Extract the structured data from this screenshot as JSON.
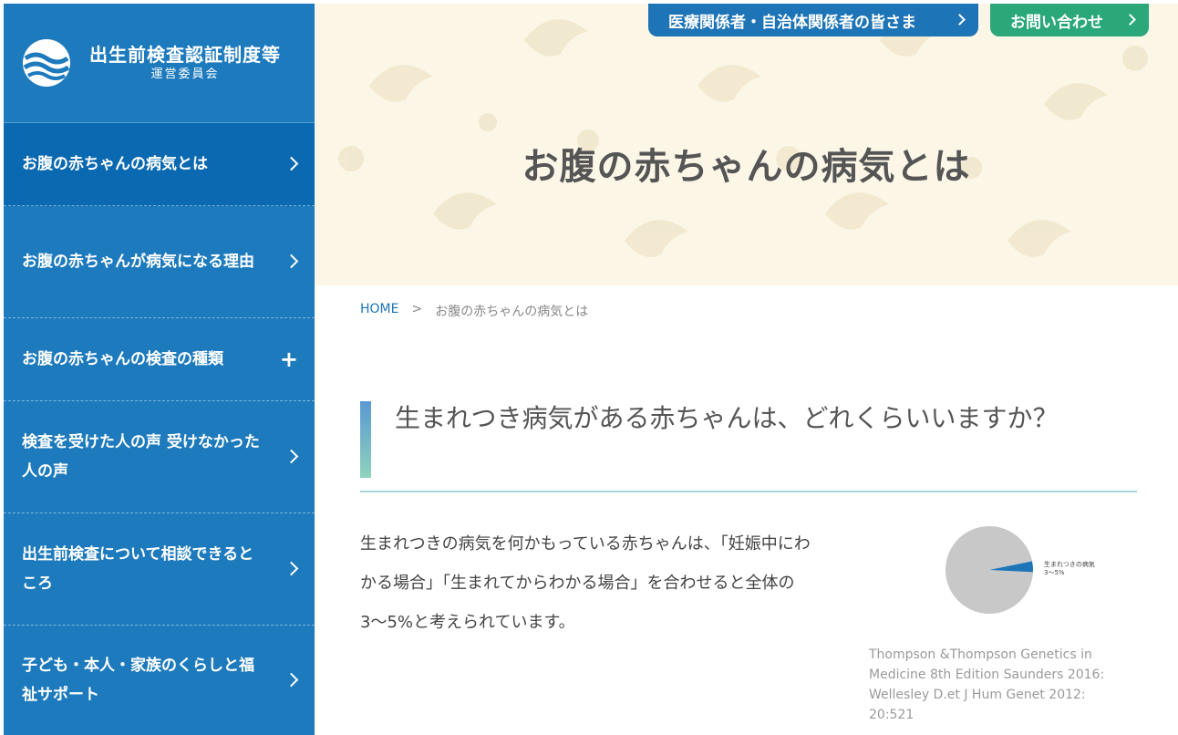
{
  "logo": {
    "title": "出生前検査認証制度等",
    "subtitle": "運営委員会"
  },
  "sidebar": {
    "items": [
      {
        "label": "お腹の赤ちゃんの病気とは",
        "indicator": "chevron-right"
      },
      {
        "label": "お腹の赤ちゃんが病気になる理由",
        "indicator": "chevron-right"
      },
      {
        "label": "お腹の赤ちゃんの検査の種類",
        "indicator": "plus"
      },
      {
        "label": "検査を受けた人の声 受けなかった人の声",
        "indicator": "chevron-right"
      },
      {
        "label": "出生前検査について相談できるところ",
        "indicator": "chevron-right"
      },
      {
        "label": "子ども・本人・家族のくらしと福祉サポート",
        "indicator": "chevron-right"
      }
    ]
  },
  "header": {
    "medical_button": "医療関係者・自治体関係者の皆さま",
    "contact_button": "お問い合わせ"
  },
  "hero": {
    "title": "お腹の赤ちゃんの病気とは"
  },
  "breadcrumb": {
    "home": "HOME",
    "separator": ">",
    "current": "お腹の赤ちゃんの病気とは"
  },
  "section": {
    "heading": "生まれつき病気がある赤ちゃんは、どれくらいいますか？",
    "body": "生まれつきの病気を何かもっている赤ちゃんは、「妊娠中にわかる場合」「生まれてからわかる場合」を合わせると全体の3〜5%と考えられています。"
  },
  "chart_data": {
    "type": "pie",
    "labels": [
      "生まれつきの病気",
      ""
    ],
    "values": [
      4,
      96
    ],
    "annotation": "3〜5%",
    "colors": [
      "#1d74b6",
      "#c8c8c8"
    ]
  },
  "citation": "Thompson &Thompson Genetics in Medicine 8th Edition Saunders 2016: Wellesley D.et J Hum Genet 2012: 20:521",
  "colors": {
    "sidebar": "#1d7abd",
    "sidebar_active": "#0a69b1",
    "hero_bg": "#fbf6e6",
    "medical_button": "#1d74b6",
    "contact_button": "#2aa87a"
  }
}
